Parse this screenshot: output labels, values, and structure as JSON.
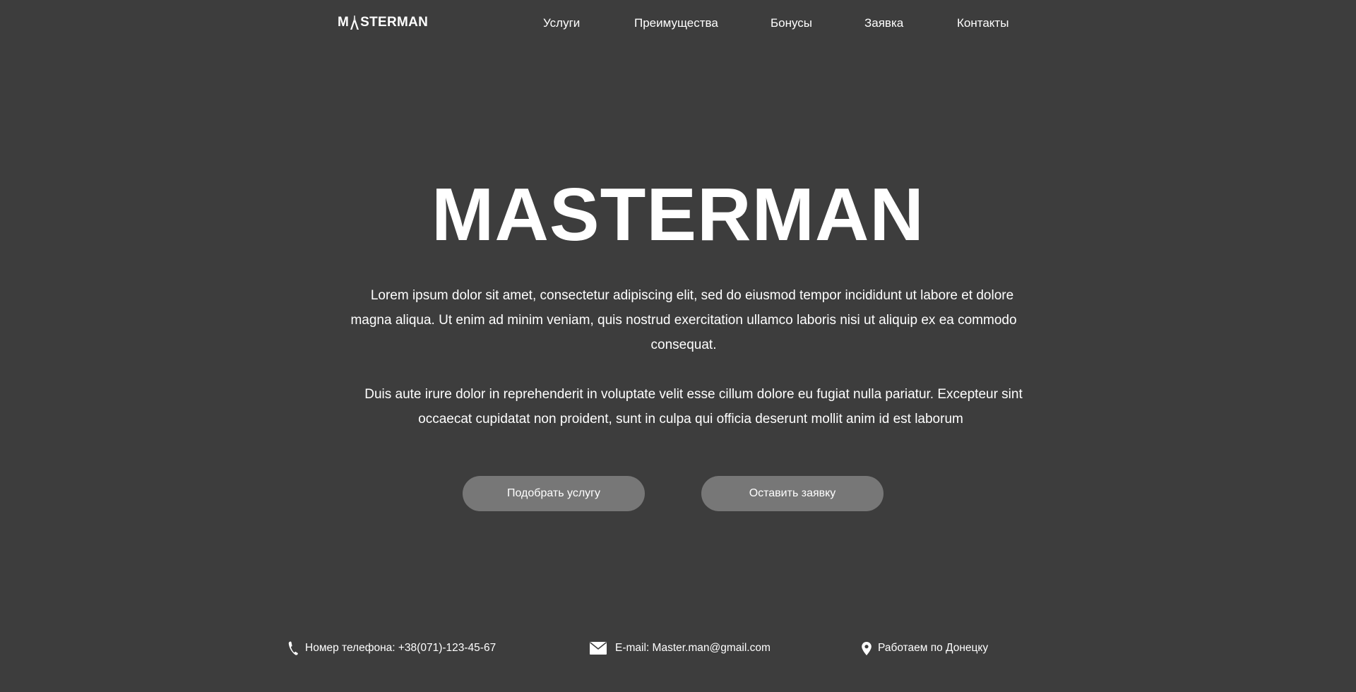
{
  "header": {
    "logo_first": "M",
    "logo_rest": "STERMAN",
    "nav": [
      {
        "label": "Услуги"
      },
      {
        "label": "Преимущества"
      },
      {
        "label": "Бонусы"
      },
      {
        "label": "Заявка"
      },
      {
        "label": "Контакты"
      }
    ]
  },
  "hero": {
    "title": "MASTERMAN",
    "paragraph_1": "Lorem ipsum dolor sit amet, consectetur adipiscing elit, sed do eiusmod tempor incididunt ut labore et dolore magna aliqua. Ut enim ad minim veniam, quis nostrud exercitation ullamco laboris nisi ut aliquip ex ea commodo consequat.",
    "paragraph_2": "Duis aute irure dolor in reprehenderit in voluptate velit esse cillum dolore eu fugiat nulla pariatur. Excepteur sint occaecat cupidatat non proident, sunt in culpa qui officia deserunt mollit anim id est laborum"
  },
  "buttons": {
    "pick_service": "Подобрать услугу",
    "leave_request": "Оставить заявку"
  },
  "contacts": {
    "phone": "Номер телефона: +38(071)-123-45-67",
    "email": "E-mail: Master.man@gmail.com",
    "location": "Работаем по Донецку"
  },
  "colors": {
    "background": "#3d3d3d",
    "button": "#777777",
    "text": "#ffffff"
  },
  "icons": {
    "logo_mark": "pliers-icon",
    "phone": "phone-icon",
    "email": "envelope-icon",
    "location": "map-pin-icon"
  }
}
